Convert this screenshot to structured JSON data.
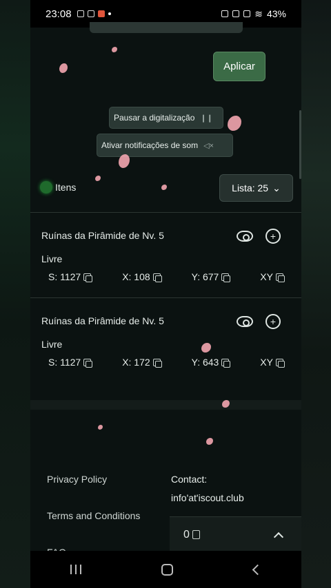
{
  "status_bar": {
    "time": "23:08",
    "battery": "43%"
  },
  "actions": {
    "apply_label": "Aplicar"
  },
  "scan_controls": {
    "pause_label": "Pausar a digitalização",
    "notifications_label": "Ativar notificações de som"
  },
  "list_header": {
    "items_label": "Itens",
    "list_button_label": "Lista: 25"
  },
  "results": [
    {
      "title": "Ruínas da Pirâmide de Nv. 5",
      "status": "Livre",
      "s": "S: 1127",
      "x": "X: 108",
      "y": "Y: 677",
      "xy": "XY"
    },
    {
      "title": "Ruínas da Pirâmide de Nv. 5",
      "status": "Livre",
      "s": "S: 1127",
      "x": "X: 172",
      "y": "Y: 643",
      "xy": "XY"
    }
  ],
  "footer": {
    "privacy": "Privacy Policy",
    "terms": "Terms and Conditions",
    "faq": "FAQ",
    "contact_label": "Contact:",
    "contact_email": "info'at'iscout.club"
  },
  "bottom_panel": {
    "count": "0"
  },
  "icons": {
    "eye": "eye-icon",
    "add": "plus-circle-icon",
    "copy": "copy-icon",
    "chevron": "chevron-down-icon",
    "sound": "speaker-mute-icon",
    "pause": "pause-icon"
  },
  "colors": {
    "accent": "#3b6b46",
    "background": "#0b1211",
    "card_bg": "#26312e"
  }
}
